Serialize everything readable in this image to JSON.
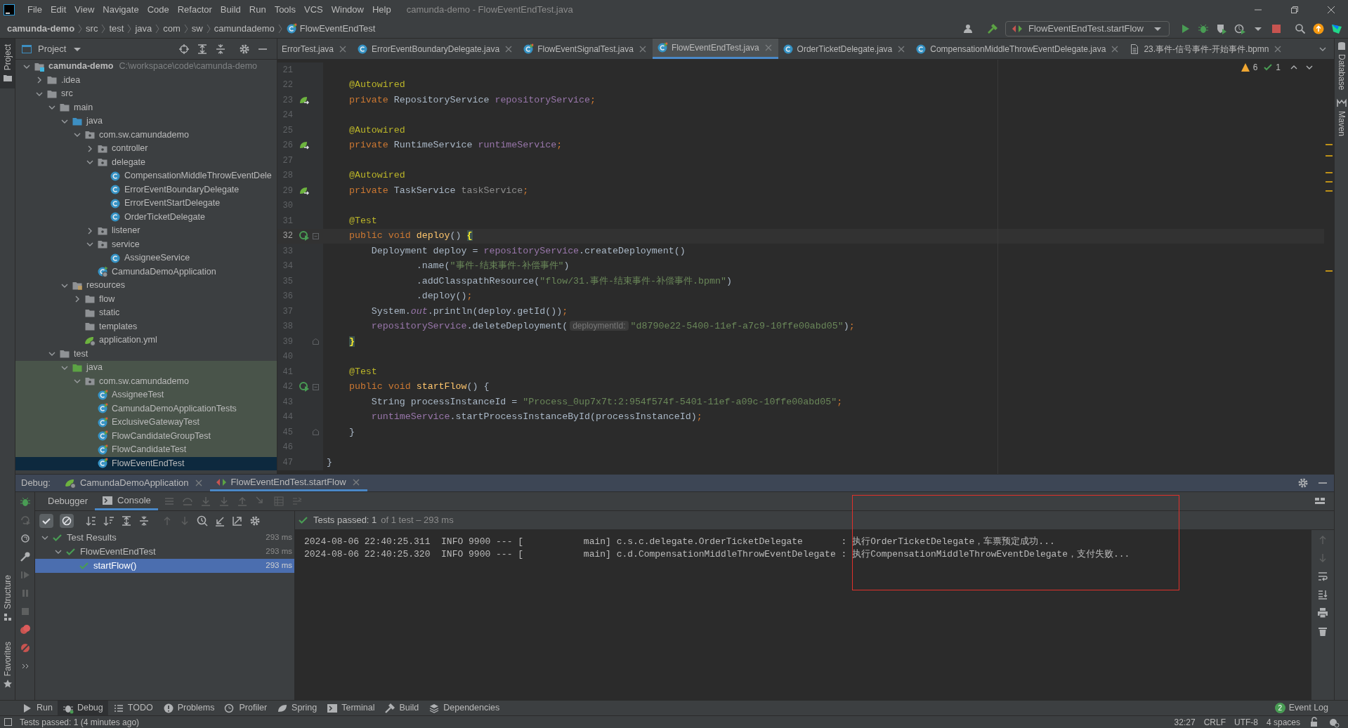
{
  "title_bar": {
    "menus": [
      "File",
      "Edit",
      "View",
      "Navigate",
      "Code",
      "Refactor",
      "Build",
      "Run",
      "Tools",
      "VCS",
      "Window",
      "Help"
    ],
    "title": "camunda-demo - FlowEventEndTest.java"
  },
  "breadcrumbs": [
    {
      "label": "camunda-demo",
      "kind": "project"
    },
    {
      "label": "src",
      "kind": "dir"
    },
    {
      "label": "test",
      "kind": "dir"
    },
    {
      "label": "java",
      "kind": "dir"
    },
    {
      "label": "com",
      "kind": "dir"
    },
    {
      "label": "sw",
      "kind": "dir"
    },
    {
      "label": "camundademo",
      "kind": "dir"
    },
    {
      "label": "FlowEventEndTest",
      "kind": "class"
    }
  ],
  "run_config": "FlowEventEndTest.startFlow",
  "left_strip": {
    "top": [
      {
        "label": "Project",
        "selected": true
      }
    ],
    "bottom": [
      {
        "label": "Structure",
        "selected": false
      },
      {
        "label": "Favorites",
        "selected": false
      }
    ]
  },
  "right_strip": [
    {
      "label": "Database"
    },
    {
      "label": "Maven"
    }
  ],
  "project_panel": {
    "title": "Project",
    "tree": [
      {
        "label": "camunda-demo",
        "path": "C:\\workspace\\code\\camunda-demo",
        "kind": "module",
        "expanded": true,
        "selected": false,
        "children": [
          {
            "label": ".idea",
            "kind": "folder",
            "expanded": false,
            "selected": false
          },
          {
            "label": "src",
            "kind": "folder",
            "expanded": true,
            "selected": false,
            "children": [
              {
                "label": "main",
                "kind": "folder",
                "expanded": true,
                "selected": false,
                "children": [
                  {
                    "label": "java",
                    "kind": "source",
                    "expanded": true,
                    "selected": false,
                    "children": [
                      {
                        "label": "com.sw.camundademo",
                        "kind": "package",
                        "expanded": true,
                        "selected": false,
                        "children": [
                          {
                            "label": "controller",
                            "kind": "package",
                            "expanded": false,
                            "selected": false
                          },
                          {
                            "label": "delegate",
                            "kind": "package",
                            "expanded": true,
                            "selected": false,
                            "children": [
                              {
                                "label": "CompensationMiddleThrowEventDele",
                                "kind": "class",
                                "selected": false
                              },
                              {
                                "label": "ErrorEventBoundaryDelegate",
                                "kind": "class",
                                "selected": false
                              },
                              {
                                "label": "ErrorEventStartDelegate",
                                "kind": "class",
                                "selected": false
                              },
                              {
                                "label": "OrderTicketDelegate",
                                "kind": "class",
                                "selected": false
                              }
                            ]
                          },
                          {
                            "label": "listener",
                            "kind": "package",
                            "expanded": false,
                            "selected": false
                          },
                          {
                            "label": "service",
                            "kind": "package",
                            "expanded": true,
                            "selected": false,
                            "children": [
                              {
                                "label": "AssigneeService",
                                "kind": "class",
                                "selected": false
                              }
                            ]
                          },
                          {
                            "label": "CamundaDemoApplication",
                            "kind": "spring-app",
                            "selected": false
                          }
                        ]
                      }
                    ]
                  },
                  {
                    "label": "resources",
                    "kind": "resources",
                    "expanded": true,
                    "selected": false,
                    "children": [
                      {
                        "label": "flow",
                        "kind": "folder",
                        "expanded": false,
                        "selected": false
                      },
                      {
                        "label": "static",
                        "kind": "folder",
                        "selected": false
                      },
                      {
                        "label": "templates",
                        "kind": "folder",
                        "selected": false
                      },
                      {
                        "label": "application.yml",
                        "kind": "yml",
                        "selected": false
                      }
                    ]
                  }
                ]
              },
              {
                "label": "test",
                "kind": "folder",
                "expanded": true,
                "selected": false,
                "children": [
                  {
                    "label": "java",
                    "kind": "test-source",
                    "expanded": true,
                    "selected": false,
                    "children": [
                      {
                        "label": "com.sw.camundademo",
                        "kind": "package",
                        "expanded": true,
                        "selected": false,
                        "children": [
                          {
                            "label": "AssigneeTest",
                            "kind": "test-class",
                            "selected": false
                          },
                          {
                            "label": "CamundaDemoApplicationTests",
                            "kind": "test-class",
                            "selected": false
                          },
                          {
                            "label": "ExclusiveGatewayTest",
                            "kind": "test-class",
                            "selected": false
                          },
                          {
                            "label": "FlowCandidateGroupTest",
                            "kind": "test-class",
                            "selected": false
                          },
                          {
                            "label": "FlowCandidateTest",
                            "kind": "test-class",
                            "selected": false
                          },
                          {
                            "label": "FlowEventEndTest",
                            "kind": "test-class",
                            "selected": true
                          }
                        ]
                      }
                    ]
                  }
                ]
              }
            ]
          }
        ]
      }
    ]
  },
  "editor": {
    "tabs": [
      {
        "label": "ErrorTest.java",
        "kind": "none",
        "selected": false
      },
      {
        "label": "ErrorEventBoundaryDelegate.java",
        "kind": "class",
        "selected": false
      },
      {
        "label": "FlowEventSignalTest.java",
        "kind": "test-class",
        "selected": false
      },
      {
        "label": "FlowEventEndTest.java",
        "kind": "test-class",
        "selected": true
      },
      {
        "label": "OrderTicketDelegate.java",
        "kind": "class",
        "selected": false
      },
      {
        "label": "CompensationMiddleThrowEventDelegate.java",
        "kind": "class",
        "selected": false
      },
      {
        "label": "23.事件-信号事件-开始事件.bpmn",
        "kind": "file",
        "selected": false
      }
    ],
    "inspections": {
      "warnings": "6",
      "passed": "1"
    },
    "lines": [
      {
        "number": "21",
        "current": false,
        "kind": "code"
      },
      {
        "number": "22",
        "current": false,
        "kind": "code",
        "tokens": [
          {
            "kind": "annotation",
            "text": "    @Autowired"
          }
        ]
      },
      {
        "number": "23",
        "current": false,
        "kind": "bean",
        "tokens": [
          {
            "kind": "keyword",
            "text": "    private "
          },
          {
            "kind": "plain",
            "text": "RepositoryService "
          },
          {
            "kind": "field",
            "text": "repositoryService"
          },
          {
            "kind": "punct",
            "text": ";"
          }
        ]
      },
      {
        "number": "24",
        "current": false,
        "kind": "code"
      },
      {
        "number": "25",
        "current": false,
        "kind": "code",
        "tokens": [
          {
            "kind": "annotation",
            "text": "    @Autowired"
          }
        ]
      },
      {
        "number": "26",
        "current": false,
        "kind": "bean",
        "tokens": [
          {
            "kind": "keyword",
            "text": "    private "
          },
          {
            "kind": "plain",
            "text": "RuntimeService "
          },
          {
            "kind": "field",
            "text": "runtimeService"
          },
          {
            "kind": "punct",
            "text": ";"
          }
        ]
      },
      {
        "number": "27",
        "current": false,
        "kind": "code"
      },
      {
        "number": "28",
        "current": false,
        "kind": "code",
        "tokens": [
          {
            "kind": "annotation",
            "text": "    @Autowired"
          }
        ]
      },
      {
        "number": "29",
        "current": false,
        "kind": "bean",
        "tokens": [
          {
            "kind": "keyword",
            "text": "    private "
          },
          {
            "kind": "plain",
            "text": "TaskService "
          },
          {
            "kind": "unused",
            "text": "taskService"
          },
          {
            "kind": "punct",
            "text": ";"
          }
        ]
      },
      {
        "number": "30",
        "current": false,
        "kind": "code"
      },
      {
        "number": "31",
        "current": false,
        "kind": "code",
        "tokens": [
          {
            "kind": "annotation",
            "text": "    @Test"
          }
        ]
      },
      {
        "number": "32",
        "current": true,
        "kind": "method",
        "tokens": [
          {
            "kind": "keyword",
            "text": "    public void "
          },
          {
            "kind": "method",
            "text": "deploy"
          },
          {
            "kind": "plain",
            "text": "() "
          },
          {
            "kind": "brace",
            "text": "{"
          }
        ]
      },
      {
        "number": "33",
        "current": false,
        "kind": "code",
        "tokens": [
          {
            "kind": "plain",
            "text": "        Deployment deploy = "
          },
          {
            "kind": "field",
            "text": "repositoryService"
          },
          {
            "kind": "plain",
            "text": ".createDeployment()"
          }
        ]
      },
      {
        "number": "34",
        "current": false,
        "kind": "code",
        "tokens": [
          {
            "kind": "plain",
            "text": "                .name("
          },
          {
            "kind": "string",
            "text": "\"事件-结束事件-补偿事件\""
          },
          {
            "kind": "plain",
            "text": ")"
          }
        ]
      },
      {
        "number": "35",
        "current": false,
        "kind": "code",
        "tokens": [
          {
            "kind": "plain",
            "text": "                .addClasspathResource("
          },
          {
            "kind": "string",
            "text": "\"flow/31.事件-结束事件-补偿事件.bpmn\""
          },
          {
            "kind": "plain",
            "text": ")"
          }
        ]
      },
      {
        "number": "36",
        "current": false,
        "kind": "code",
        "tokens": [
          {
            "kind": "plain",
            "text": "                .deploy()"
          },
          {
            "kind": "punct",
            "text": ";"
          }
        ]
      },
      {
        "number": "37",
        "current": false,
        "kind": "code",
        "tokens": [
          {
            "kind": "plain",
            "text": "        System."
          },
          {
            "kind": "static",
            "text": "out"
          },
          {
            "kind": "plain",
            "text": ".println(deploy.getId())"
          },
          {
            "kind": "punct",
            "text": ";"
          }
        ]
      },
      {
        "number": "38",
        "current": false,
        "kind": "code",
        "tokens": [
          {
            "kind": "field",
            "text": "        repositoryService"
          },
          {
            "kind": "plain",
            "text": ".deleteDeployment("
          },
          {
            "kind": "hint",
            "text": "deploymentId:"
          },
          {
            "kind": "string",
            "text": "\"d8790e22-5400-11ef-a7c9-10ffe00abd05\""
          },
          {
            "kind": "plain",
            "text": ")"
          },
          {
            "kind": "punct",
            "text": ";"
          }
        ]
      },
      {
        "number": "39",
        "current": false,
        "kind": "close",
        "tokens": [
          {
            "kind": "brace",
            "text": "    }"
          }
        ]
      },
      {
        "number": "40",
        "current": false,
        "kind": "code"
      },
      {
        "number": "41",
        "current": false,
        "kind": "code",
        "tokens": [
          {
            "kind": "annotation",
            "text": "    @Test"
          }
        ]
      },
      {
        "number": "42",
        "current": false,
        "kind": "method",
        "tokens": [
          {
            "kind": "keyword",
            "text": "    public void "
          },
          {
            "kind": "method",
            "text": "startFlow"
          },
          {
            "kind": "plain",
            "text": "() {"
          }
        ]
      },
      {
        "number": "43",
        "current": false,
        "kind": "code",
        "tokens": [
          {
            "kind": "plain",
            "text": "        String processInstanceId = "
          },
          {
            "kind": "string",
            "text": "\"Process_0up7x7t:2:954f574f-5401-11ef-a09c-10ffe00abd05\""
          },
          {
            "kind": "punct",
            "text": ";"
          }
        ]
      },
      {
        "number": "44",
        "current": false,
        "kind": "code",
        "tokens": [
          {
            "kind": "field",
            "text": "        runtimeService"
          },
          {
            "kind": "plain",
            "text": ".startProcessInstanceById(processInstanceId)"
          },
          {
            "kind": "punct",
            "text": ";"
          }
        ]
      },
      {
        "number": "45",
        "current": false,
        "kind": "close",
        "tokens": [
          {
            "kind": "plain",
            "text": "    }"
          }
        ]
      },
      {
        "number": "46",
        "current": false,
        "kind": "code"
      },
      {
        "number": "47",
        "current": false,
        "kind": "code",
        "tokens": [
          {
            "kind": "plain",
            "text": "}"
          }
        ]
      }
    ]
  },
  "debug": {
    "label": "Debug:",
    "sessions": [
      {
        "label": "CamundaDemoApplication",
        "kind": "spring",
        "selected": false
      },
      {
        "label": "FlowEventEndTest.startFlow",
        "kind": "test",
        "selected": true
      }
    ],
    "subtabs": [
      {
        "label": "Debugger",
        "selected": false
      },
      {
        "label": "Console",
        "selected": true
      }
    ],
    "filters": [
      {
        "kind": "passed",
        "on": true
      },
      {
        "kind": "ignored",
        "on": true
      }
    ],
    "summary": {
      "status": "Tests passed: 1",
      "detail": "of 1 test – 293 ms"
    },
    "results": [
      {
        "label": "Test Results",
        "time": "293 ms",
        "expanded": true,
        "selected": false,
        "children": [
          {
            "label": "FlowEventEndTest",
            "time": "293 ms",
            "expanded": true,
            "selected": false,
            "children": [
              {
                "label": "startFlow()",
                "time": "293 ms",
                "selected": true
              }
            ]
          }
        ]
      }
    ],
    "console": [
      "2024-08-06 22:40:25.311  INFO 9900 --- [           main] c.s.c.delegate.OrderTicketDelegate       : 执行OrderTicketDelegate，车票预定成功...",
      "2024-08-06 22:40:25.320  INFO 9900 --- [           main] c.d.CompensationMiddleThrowEventDelegate : 执行CompensationMiddleThrowEventDelegate，支付失败..."
    ]
  },
  "tool_windows": [
    {
      "label": "Run",
      "kind": "run",
      "selected": false
    },
    {
      "label": "Debug",
      "kind": "debug",
      "selected": true
    },
    {
      "label": "TODO",
      "kind": "list",
      "selected": false
    },
    {
      "label": "Problems",
      "kind": "info",
      "selected": false
    },
    {
      "label": "Profiler",
      "kind": "profiler",
      "selected": false
    },
    {
      "label": "Spring",
      "kind": "leaf",
      "selected": false
    },
    {
      "label": "Terminal",
      "kind": "terminal",
      "selected": false
    },
    {
      "label": "Build",
      "kind": "hammer",
      "selected": false
    },
    {
      "label": "Dependencies",
      "kind": "layers",
      "selected": false
    }
  ],
  "event_log": {
    "count": "2",
    "label": "Event Log"
  },
  "status_bar": {
    "message": "Tests passed: 1 (4 minutes ago)",
    "position": "32:27",
    "line_ending": "CRLF",
    "encoding": "UTF-8",
    "indent": "4 spaces"
  }
}
